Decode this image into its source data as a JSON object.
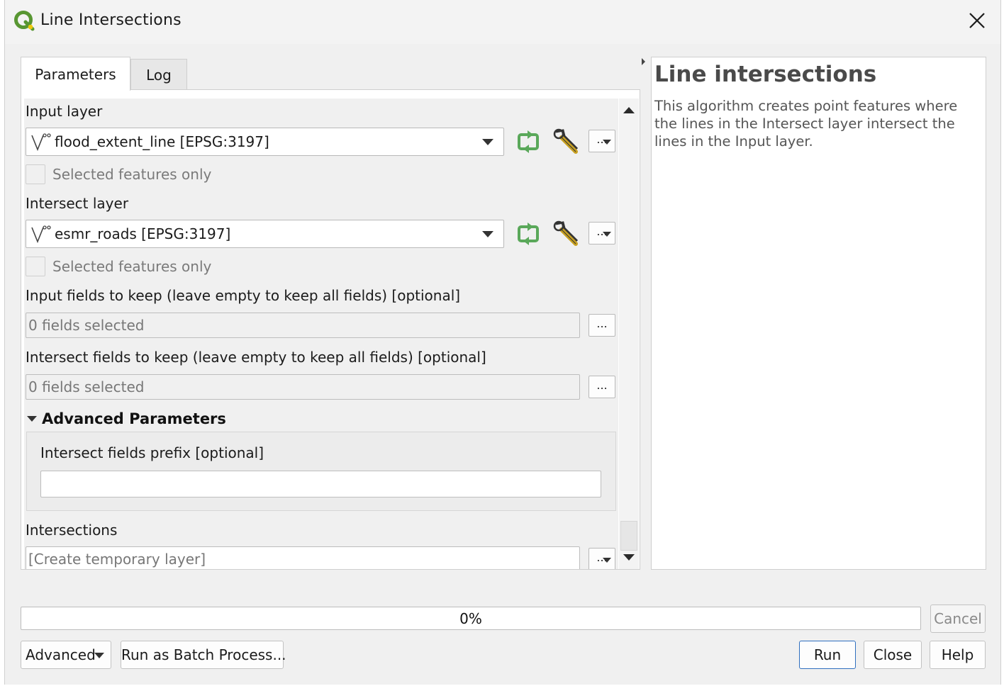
{
  "window": {
    "title": "Line Intersections"
  },
  "tabs": [
    {
      "label": "Parameters",
      "active": true
    },
    {
      "label": "Log",
      "active": false
    }
  ],
  "params": {
    "input_layer": {
      "label": "Input layer",
      "value": "flood_extent_line [EPSG:3197]",
      "selected_only_label": "Selected features only",
      "selected_only_checked": false
    },
    "intersect_layer": {
      "label": "Intersect layer",
      "value": "esmr_roads [EPSG:3197]",
      "selected_only_label": "Selected features only",
      "selected_only_checked": false
    },
    "input_fields": {
      "label": "Input fields to keep (leave empty to keep all fields) [optional]",
      "value": "0 fields selected",
      "button": "..."
    },
    "intersect_fields": {
      "label": "Intersect fields to keep (leave empty to keep all fields) [optional]",
      "value": "0 fields selected",
      "button": "..."
    },
    "advanced": {
      "header": "Advanced Parameters",
      "prefix_label": "Intersect fields prefix [optional]",
      "prefix_value": ""
    },
    "output": {
      "label": "Intersections",
      "placeholder": "[Create temporary layer]",
      "button": "..."
    },
    "layer_more_button": "..."
  },
  "help": {
    "title": "Line intersections",
    "body": "This algorithm creates point features where the lines in the Intersect layer intersect the lines in the Input layer."
  },
  "progress": {
    "value": 0,
    "label": "0%"
  },
  "buttons": {
    "cancel": "Cancel",
    "advanced": "Advanced",
    "batch": "Run as Batch Process...",
    "run": "Run",
    "close": "Close",
    "help": "Help"
  },
  "colors": {
    "accent": "#2f6fbf",
    "refresh_icon": "#5aa85a",
    "qgis_green": "#589632",
    "qgis_yellow": "#eec90d"
  }
}
